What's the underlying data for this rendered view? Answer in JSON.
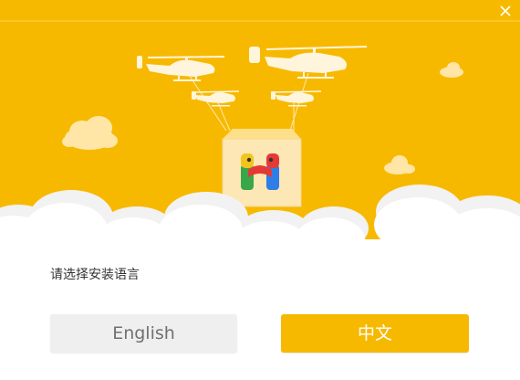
{
  "window": {
    "title": "",
    "close_icon": "close-icon"
  },
  "colors": {
    "accent": "#f7b900",
    "sky": "#f7b900",
    "cloud": "#ffffff",
    "button_neutral": "#efefef",
    "text_dark": "#333333"
  },
  "hero": {
    "illustration": "helicopters-carrying-app-box",
    "logo_icon": "hapi-h-logo-icon",
    "helicopter_count": 4
  },
  "language_select": {
    "prompt": "请选择安装语言",
    "english_label": "English",
    "chinese_label": "中文"
  }
}
